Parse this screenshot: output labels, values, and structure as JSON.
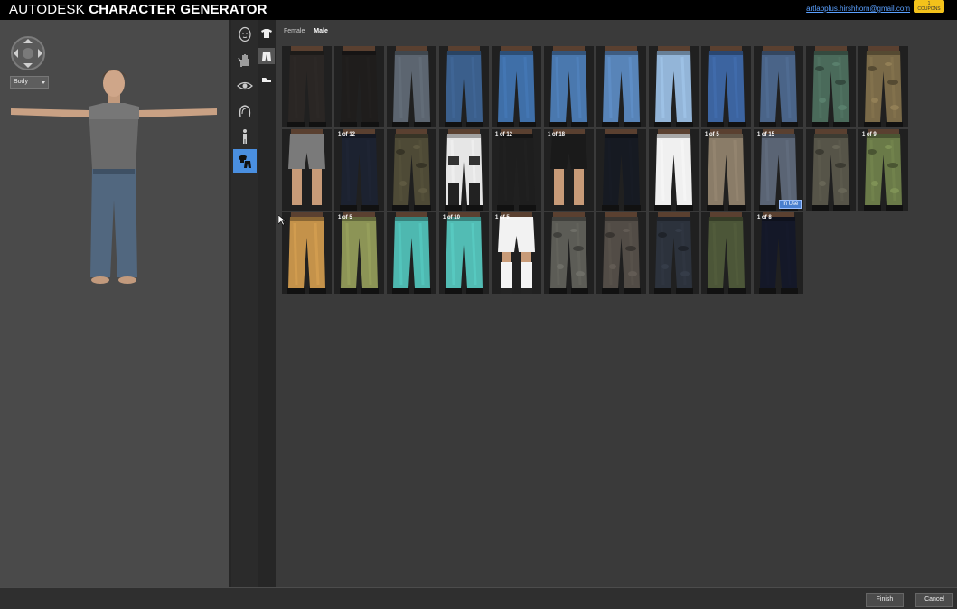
{
  "header": {
    "brand": "AUTODESK",
    "product": "CHARACTER GENERATOR",
    "user_email": "artlabplus.hirshhorn@gmail.com",
    "coupons_count": "1",
    "coupons_label": "COUPONS"
  },
  "viewport": {
    "body_select_value": "Body"
  },
  "categories": [
    {
      "name": "head-icon",
      "active": false
    },
    {
      "name": "hands-icon",
      "active": false
    },
    {
      "name": "eye-icon",
      "active": false
    },
    {
      "name": "hair-icon",
      "active": false
    },
    {
      "name": "body-icon",
      "active": false
    },
    {
      "name": "clothing-icon",
      "active": true
    }
  ],
  "subcategories": [
    {
      "name": "shirt-icon",
      "active": false
    },
    {
      "name": "pants-icon",
      "active": true
    },
    {
      "name": "shoes-icon",
      "active": false
    }
  ],
  "gender_tabs": [
    {
      "label": "Female",
      "active": false
    },
    {
      "label": "Male",
      "active": true
    }
  ],
  "items": [
    {
      "color": "#2a2624",
      "style": "pants",
      "badge": ""
    },
    {
      "color": "#1f1d1c",
      "style": "pants",
      "badge": ""
    },
    {
      "color": "#5c6570",
      "style": "pants",
      "badge": ""
    },
    {
      "color": "#3b5f8c",
      "style": "pants",
      "badge": ""
    },
    {
      "color": "#3f6fa8",
      "style": "pants",
      "badge": ""
    },
    {
      "color": "#4a78ae",
      "style": "pants",
      "badge": ""
    },
    {
      "color": "#5884b8",
      "style": "pants",
      "badge": ""
    },
    {
      "color": "#93b5d8",
      "style": "pants",
      "badge": ""
    },
    {
      "color": "#3c64a0",
      "style": "pants",
      "badge": ""
    },
    {
      "color": "#4a6488",
      "style": "pants",
      "badge": ""
    },
    {
      "color": "#4a6a5a",
      "style": "camo",
      "badge": ""
    },
    {
      "color": "#7a6a48",
      "style": "camo",
      "badge": ""
    },
    {
      "color": "#7a7a7a",
      "style": "shorts",
      "badge": ""
    },
    {
      "color": "#1c2230",
      "style": "pants",
      "badge": "1 of 12"
    },
    {
      "color": "#4e4a36",
      "style": "camo",
      "badge": ""
    },
    {
      "color": "#e6e6e6",
      "style": "armor",
      "badge": ""
    },
    {
      "color": "#1e1e1e",
      "style": "pants",
      "badge": "1 of 12"
    },
    {
      "color": "#1a1a1a",
      "style": "shorts",
      "badge": "1 of 18"
    },
    {
      "color": "#161a22",
      "style": "pants",
      "badge": ""
    },
    {
      "color": "#f0f0f0",
      "style": "pants",
      "badge": ""
    },
    {
      "color": "#8a7c68",
      "style": "pants",
      "badge": "1 of 5"
    },
    {
      "color": "#5a6474",
      "style": "pants",
      "badge": "1 of 15",
      "in_use": "In Use"
    },
    {
      "color": "#565448",
      "style": "camo",
      "badge": ""
    },
    {
      "color": "#6a7a48",
      "style": "camo",
      "badge": "1 of 9"
    },
    {
      "color": "#c4924a",
      "style": "pants",
      "badge": ""
    },
    {
      "color": "#8c9456",
      "style": "pants",
      "badge": "1 of 5"
    },
    {
      "color": "#4eb8b0",
      "style": "pants",
      "badge": ""
    },
    {
      "color": "#52bcb4",
      "style": "pants",
      "badge": "1 of 10"
    },
    {
      "color": "#f2f2f2",
      "style": "soccer",
      "badge": "1 of 5"
    },
    {
      "color": "#5c5c56",
      "style": "camo",
      "badge": ""
    },
    {
      "color": "#524c46",
      "style": "camo",
      "badge": ""
    },
    {
      "color": "#2c323c",
      "style": "camo",
      "badge": ""
    },
    {
      "color": "#4c5638",
      "style": "pants",
      "badge": ""
    },
    {
      "color": "#141828",
      "style": "pants",
      "badge": "1 of 8"
    }
  ],
  "footer": {
    "finish_label": "Finish",
    "cancel_label": "Cancel"
  }
}
